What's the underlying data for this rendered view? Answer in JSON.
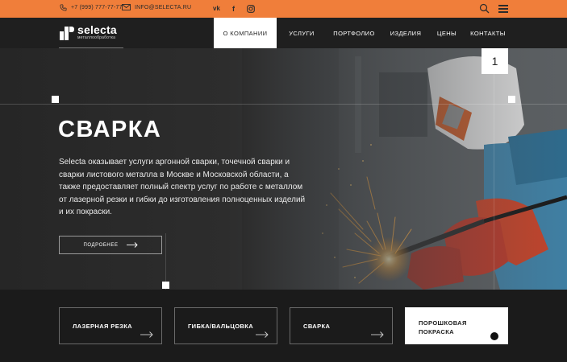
{
  "topbar": {
    "phone": "+7 (999) 777-77-77",
    "email": "INFO@SELECTA.RU",
    "social": [
      "vk-icon",
      "facebook-icon",
      "instagram-icon"
    ]
  },
  "logo": {
    "name": "selecta",
    "sub": "металлообработка"
  },
  "nav": [
    {
      "label": "О КОМПАНИИ",
      "active": true
    },
    {
      "label": "УСЛУГИ"
    },
    {
      "label": "ПОРТФОЛИО"
    },
    {
      "label": "ИЗДЕЛИЯ"
    },
    {
      "label": "ЦЕНЫ"
    },
    {
      "label": "КОНТАКТЫ"
    }
  ],
  "hero": {
    "slide_number": "1",
    "title": "СВАРКА",
    "description": "Selecta оказывает услуги аргонной сварки, точечной сварки и сварки листового металла в Москве и Московской области, а также предоставляет полный спектр услуг по работе с металлом от лазерной резки и гибки до изготовления полноценных изделий и их покраски.",
    "button": "ПОДРОБНЕЕ"
  },
  "cards": [
    {
      "label": "ЛАЗЕРНАЯ РЕЗКА"
    },
    {
      "label": "ГИБКА/ВАЛЬЦОВКА"
    },
    {
      "label": "СВАРКА"
    },
    {
      "label_line1": "ПОРОШКОВАЯ",
      "label_line2": "ПОКРАСКА"
    }
  ],
  "colors": {
    "accent": "#f07e3a",
    "dark": "#1f1f1f",
    "glove": "#c2432a"
  }
}
